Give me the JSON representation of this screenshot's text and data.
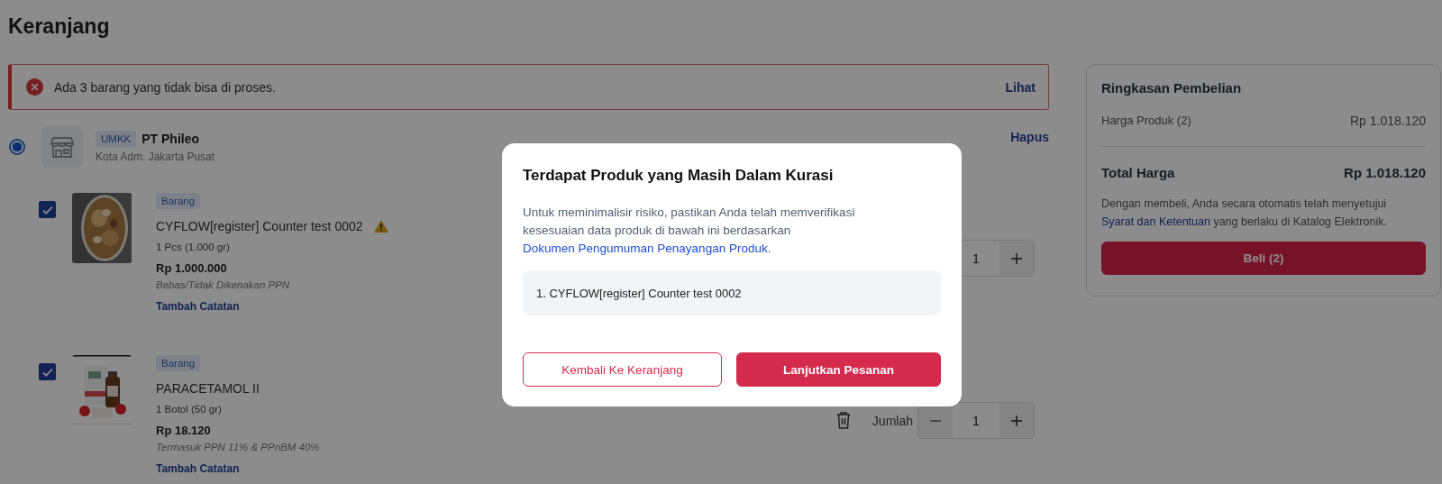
{
  "page": {
    "title": "Keranjang"
  },
  "alert": {
    "message": "Ada 3 barang yang tidak bisa di proses.",
    "action": "Lihat"
  },
  "store": {
    "selected": true,
    "badge": "UMKK",
    "name": "PT Phileo",
    "location": "Kota Adm. Jakarta Pusat",
    "action": "Hapus"
  },
  "items": [
    {
      "checked": true,
      "tag": "Barang",
      "name": "CYFLOW[register] Counter test 0002",
      "warning": true,
      "unit": "1 Pcs (1.000 gr)",
      "price": "Rp 1.000.000",
      "tax": "Bebas/Tidak Dikenakan PPN",
      "note_link": "Tambah Catatan",
      "quantity": "1"
    },
    {
      "checked": true,
      "tag": "Barang",
      "name": "PARACETAMOL II",
      "warning": false,
      "unit": "1 Botol (50 gr)",
      "price": "Rp 18.120",
      "tax": "Termasuk PPN 11% & PPnBM 40%",
      "note_link": "Tambah Catatan",
      "quantity_label": "Jumlah",
      "quantity": "1"
    }
  ],
  "summary": {
    "title": "Ringkasan Pembelian",
    "rows": [
      {
        "label": "Harga Produk (2)",
        "value": "Rp 1.018.120"
      }
    ],
    "total": {
      "label": "Total Harga",
      "value": "Rp 1.018.120"
    },
    "terms": "Dengan membeli, Anda secara otomatis telah menyetujui ",
    "terms_link": "Syarat dan Ketentuan",
    "terms_end": " yang berlaku di Katalog Elektronik.",
    "button": "Beli (2)"
  },
  "modal": {
    "title": "Terdapat Produk yang Masih Dalam Kurasi",
    "body": "Untuk meminimalisir risiko, pastikan Anda telah memverifikasi kesesuaian data produk di bawah ini berdasarkan ",
    "link": "Dokumen Pengumuman Penayangan Produk",
    "body_end": ".",
    "products": [
      "1. CYFLOW[register] Counter test 0002"
    ],
    "buttons": [
      {
        "label": "Kembali Ke Keranjang",
        "kind": "secondary"
      },
      {
        "label": "Lanjutkan Pesanan",
        "kind": "primary"
      }
    ]
  }
}
